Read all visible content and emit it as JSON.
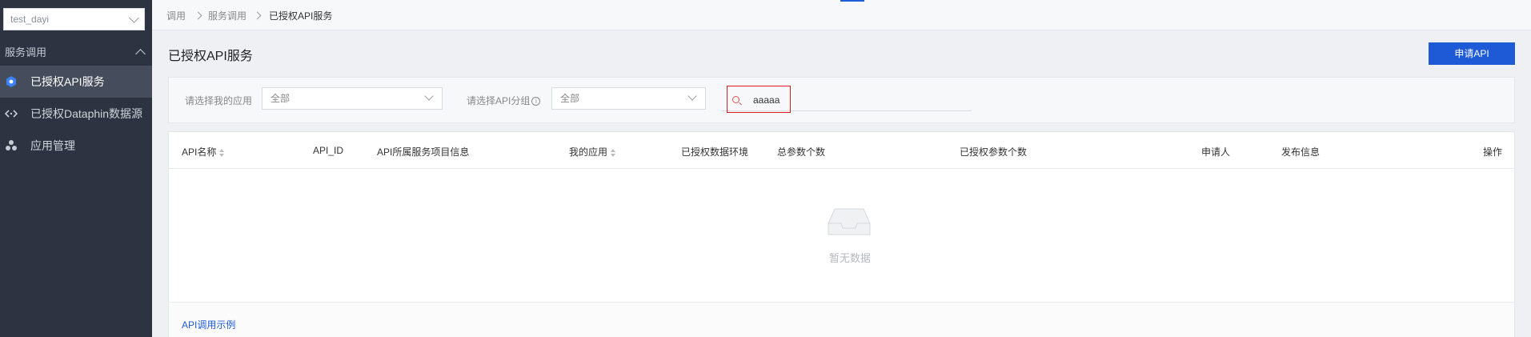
{
  "sidebar": {
    "workspace": "test_dayi",
    "group_title": "服务调用",
    "items": [
      {
        "label": "已授权API服务",
        "icon": "api-service-icon"
      },
      {
        "label": "已授权Dataphin数据源",
        "icon": "code-brackets-icon"
      },
      {
        "label": "应用管理",
        "icon": "app-cluster-icon"
      }
    ]
  },
  "breadcrumb": [
    "调用",
    "服务调用",
    "已授权API服务"
  ],
  "page": {
    "title": "已授权API服务",
    "apply_button": "申请API"
  },
  "filters": {
    "app_label": "请选择我的应用",
    "app_value": "全部",
    "group_label": "请选择API分组",
    "group_value": "全部",
    "search_value": "aaaaa"
  },
  "table": {
    "columns": [
      "API名称",
      "API_ID",
      "API所属服务项目信息",
      "我的应用",
      "已授权数据环境",
      "总参数个数",
      "已授权参数个数",
      "申请人",
      "发布信息",
      "操作"
    ],
    "empty_text": "暂无数据"
  },
  "footer": {
    "example_link": "API调用示例"
  },
  "colors": {
    "sidebar_bg": "#2d3340",
    "accent": "#1f5ad6",
    "highlight": "#e0191f"
  }
}
